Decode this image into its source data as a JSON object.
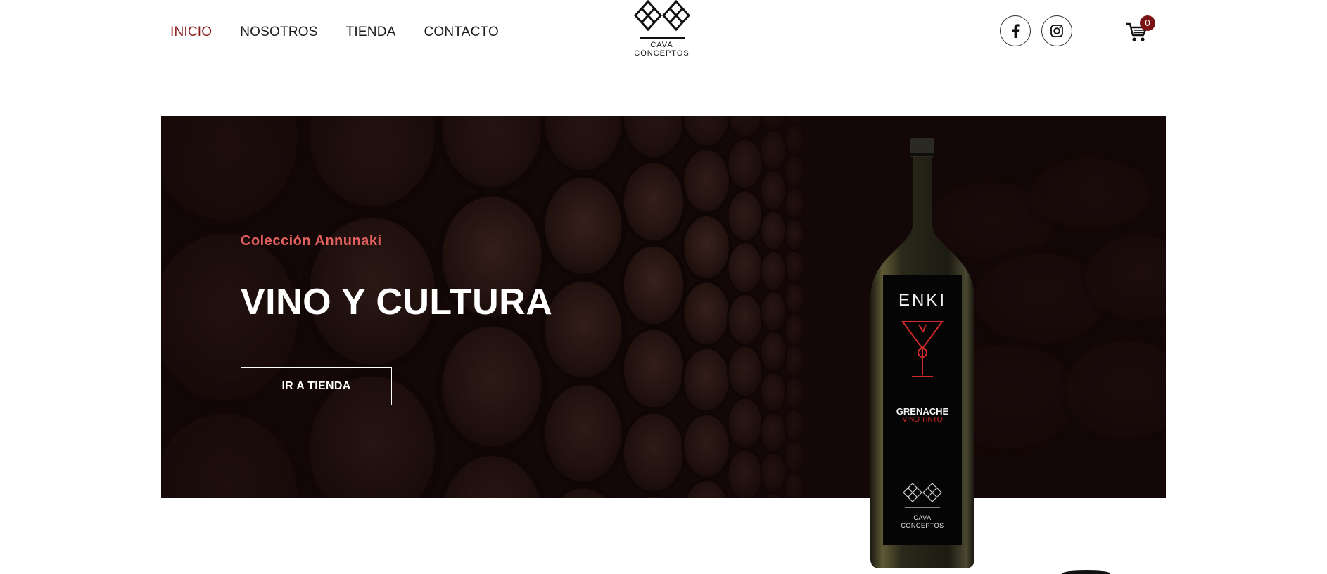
{
  "nav": {
    "items": [
      {
        "label": "INICIO",
        "active": true
      },
      {
        "label": "NOSOTROS",
        "active": false
      },
      {
        "label": "TIENDA",
        "active": false
      },
      {
        "label": "CONTACTO",
        "active": false
      }
    ]
  },
  "logo": {
    "line1": "CAVA",
    "line2": "CONCEPTOS"
  },
  "social": {
    "facebook_icon": "facebook-icon",
    "instagram_icon": "instagram-icon"
  },
  "cart": {
    "icon": "cart-icon",
    "count": "0"
  },
  "hero": {
    "subtitle": "Colección Annunaki",
    "title": "VINO Y CULTURA",
    "button_label": "IR A TIENDA"
  },
  "bottle": {
    "name": "ENKI",
    "grape": "GRENACHE",
    "type": "VINO TINTO",
    "brand_line1": "CAVA",
    "brand_line2": "CONCEPTOS"
  },
  "colors": {
    "accent": "#8a1c1c",
    "subtitle": "#e2605d",
    "badge": "#7a1414",
    "hero_bg": "#140707"
  }
}
